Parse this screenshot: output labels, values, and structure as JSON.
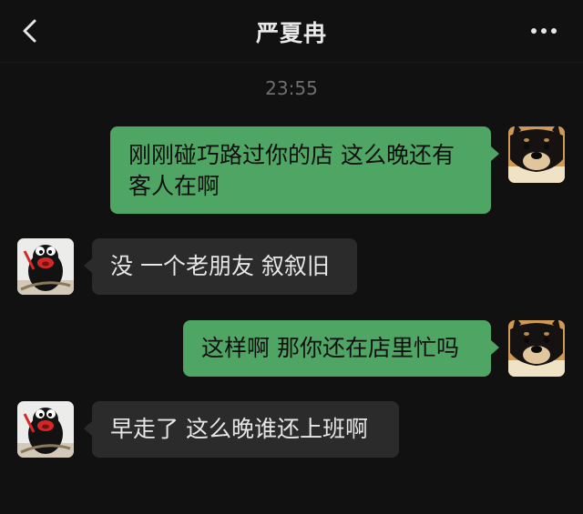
{
  "header": {
    "title": "严夏冉",
    "back_icon": "chevron-left-icon",
    "more_icon": "more-dots-icon"
  },
  "timestamp": "23:55",
  "messages": [
    {
      "from": "me",
      "text": "刚刚碰巧路过你的店 这么晚还有客人在啊"
    },
    {
      "from": "contact",
      "text": "没 一个老朋友 叙叙旧"
    },
    {
      "from": "me",
      "text": "这样啊 那你还在店里忙吗"
    },
    {
      "from": "contact",
      "text": "早走了 这么晚谁还上班啊"
    }
  ],
  "colors": {
    "background": "#111111",
    "outgoing_bubble": "#4fa564",
    "incoming_bubble": "#2b2b2b",
    "timestamp": "#6e6e6e"
  }
}
